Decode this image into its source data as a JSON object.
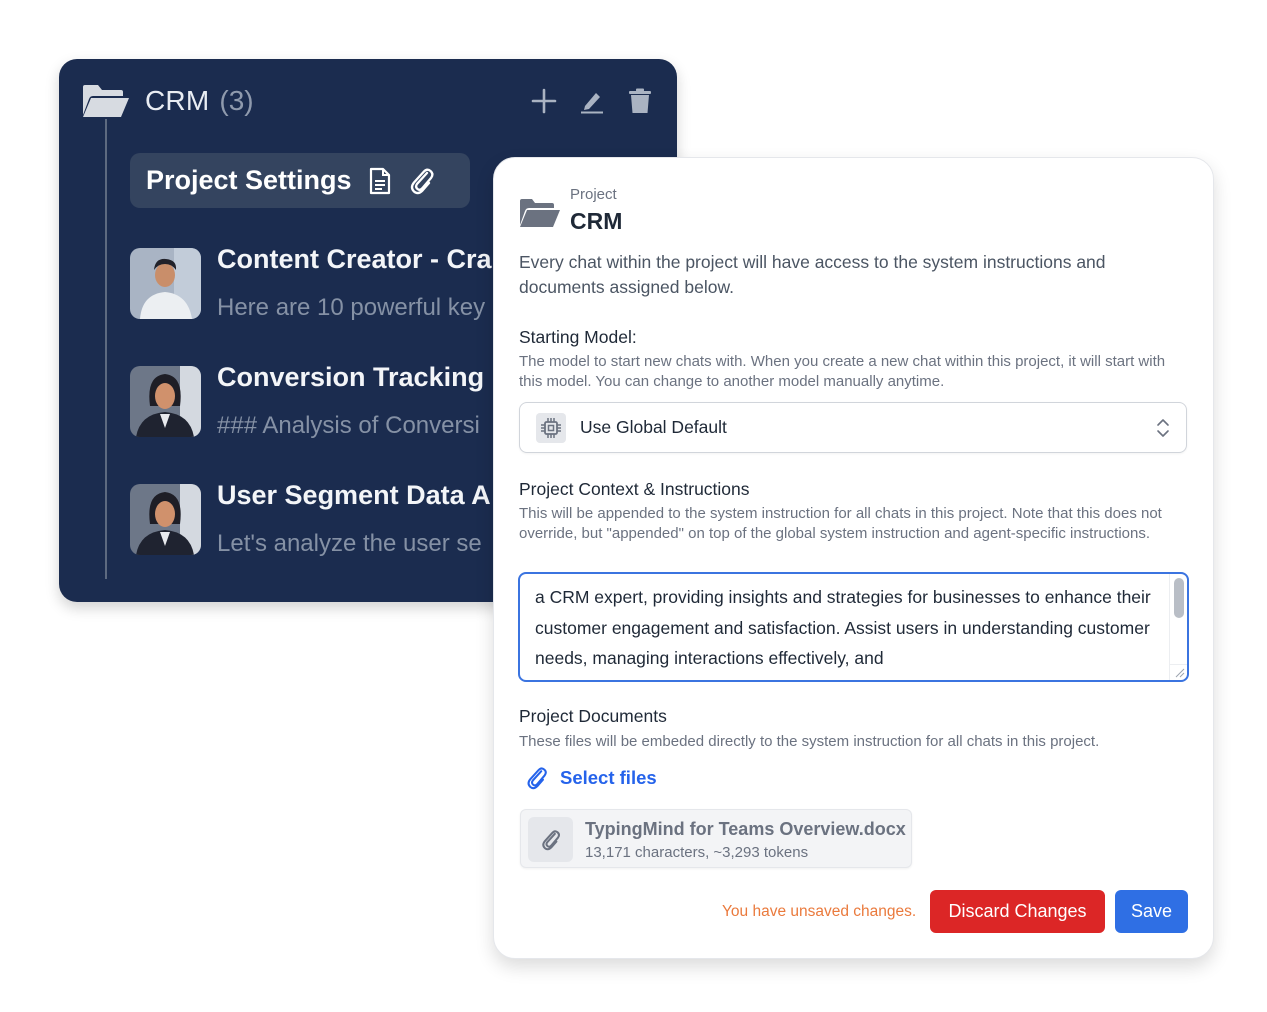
{
  "sidebar": {
    "folder_name": "CRM",
    "folder_count": "(3)",
    "actions": [
      {
        "name": "add",
        "icon": "plus-icon"
      },
      {
        "name": "edit",
        "icon": "pencil-icon"
      },
      {
        "name": "delete",
        "icon": "trash-icon"
      }
    ],
    "project_settings_label": "Project Settings",
    "project_settings_icons": [
      "document-icon",
      "paperclip-icon"
    ],
    "chats": [
      {
        "title": "Content Creator - Cra",
        "preview": "Here are 10 powerful key",
        "avatar": "man-white-tshirt"
      },
      {
        "title": "Conversion Tracking I",
        "preview": "### Analysis of Conversi",
        "avatar": "woman-dark-blazer"
      },
      {
        "title": "User Segment Data A",
        "preview": "Let's analyze the user se",
        "avatar": "woman-dark-blazer"
      }
    ]
  },
  "settings": {
    "kicker": "Project",
    "title": "CRM",
    "intro": "Every chat within the project will have access to the system instructions and documents assigned below.",
    "starting_model": {
      "label": "Starting Model:",
      "description": "The model to start new chats with. When you create a new chat within this project, it will start with this model. You can change to another model manually anytime.",
      "selected": "Use Global Default",
      "icon": "chip-icon"
    },
    "context": {
      "label": "Project Context & Instructions",
      "description": "This will be appended to the system instruction for all chats in this project. Note that this does not override, but \"appended\" on top of the global system instruction and agent-specific instructions.",
      "value": "a CRM expert, providing insights and strategies for businesses to enhance their customer engagement and satisfaction. Assist users in understanding customer needs, managing interactions effectively, and"
    },
    "documents": {
      "label": "Project Documents",
      "description": "These files will be embeded directly to the system instruction for all chats in this project.",
      "select_files_label": "Select files",
      "files": [
        {
          "name": "TypingMind for Teams Overview.docx",
          "meta": "13,171 characters, ~3,293 tokens"
        }
      ]
    },
    "footer": {
      "unsaved_text": "You have unsaved changes.",
      "discard_label": "Discard Changes",
      "save_label": "Save"
    }
  },
  "colors": {
    "sidebar_bg": "#1b2c4f",
    "accent_blue": "#2f6fe4",
    "danger_red": "#dc2626",
    "warning_orange": "#ea7a3d"
  }
}
